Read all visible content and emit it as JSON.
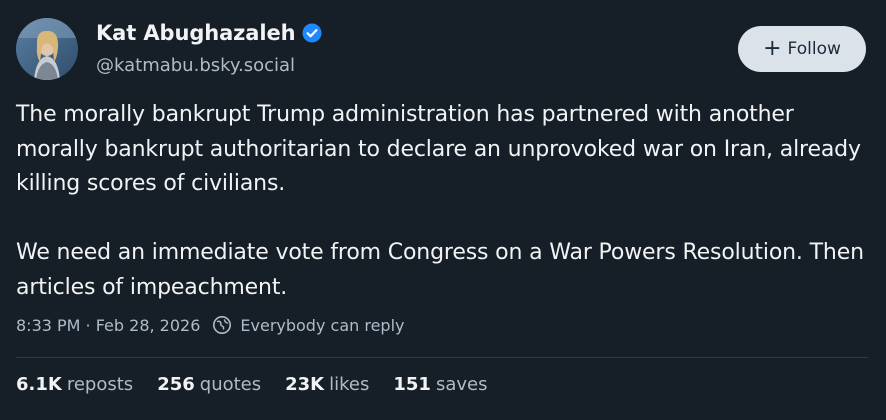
{
  "author": {
    "display_name": "Kat Abughazaleh",
    "handle": "@katmabu.bsky.social",
    "verified": true,
    "avatar_icon": "profile-photo"
  },
  "follow_button": {
    "label": "Follow",
    "icon": "plus-icon"
  },
  "post": {
    "paragraphs": [
      "The morally bankrupt Trump administration has partnered with another morally bankrupt authoritarian to declare an unprovoked war on Iran, already killing scores of civilians.",
      "We need an immediate vote from Congress on a War Powers Resolution. Then articles of impeachment."
    ],
    "timestamp": "8:33 PM · Feb 28, 2026",
    "reply_setting": "Everybody can reply"
  },
  "stats": [
    {
      "count": "6.1K",
      "label": "reposts"
    },
    {
      "count": "256",
      "label": "quotes"
    },
    {
      "count": "23K",
      "label": "likes"
    },
    {
      "count": "151",
      "label": "saves"
    }
  ],
  "colors": {
    "background": "#161e27",
    "text_primary": "#f1f3f5",
    "text_secondary": "#aebbc9",
    "verified_badge": "#1e88ff",
    "follow_bg": "#dce2ea",
    "divider": "#2c3a4a"
  }
}
